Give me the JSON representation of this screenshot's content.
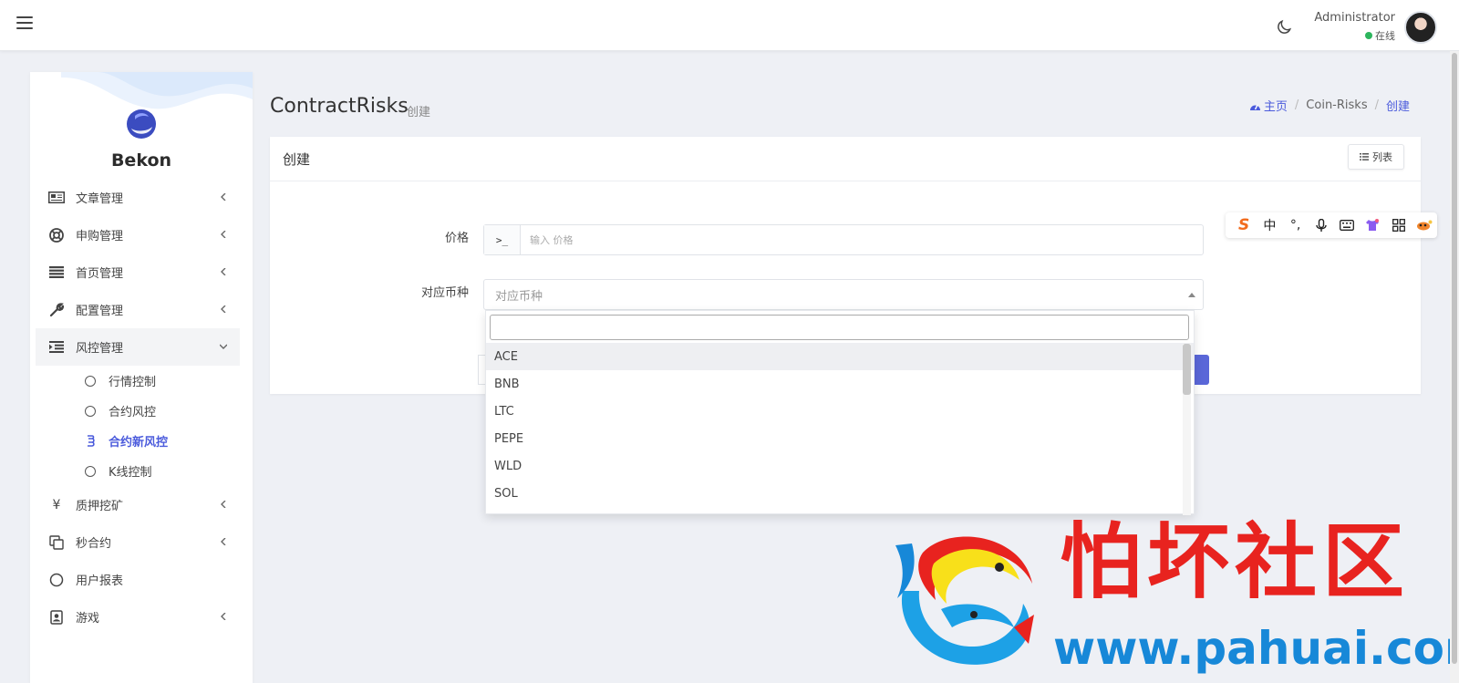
{
  "header": {
    "user_name": "Administrator",
    "user_status": "在线"
  },
  "sidebar": {
    "brand": "Bekon",
    "items": [
      {
        "label": "文章管理",
        "icon": "newspaper-icon"
      },
      {
        "label": "申购管理",
        "icon": "lifebuoy-icon"
      },
      {
        "label": "首页管理",
        "icon": "bars-icon"
      },
      {
        "label": "配置管理",
        "icon": "wrench-icon"
      },
      {
        "label": "风控管理",
        "icon": "indent-icon"
      },
      {
        "label": "质押挖矿",
        "icon": "yen-icon"
      },
      {
        "label": "秒合约",
        "icon": "copy-icon"
      },
      {
        "label": "用户报表",
        "icon": "circle-icon"
      },
      {
        "label": "游戏",
        "icon": "user-card-icon"
      }
    ],
    "subitems": [
      {
        "label": "行情控制"
      },
      {
        "label": "合约风控"
      },
      {
        "label": "合约新风控"
      },
      {
        "label": "K线控制"
      }
    ]
  },
  "page": {
    "title": "ContractRisks",
    "subtitle": "创建"
  },
  "breadcrumb": {
    "home": "主页",
    "section": "Coin-Risks",
    "current": "创建"
  },
  "card": {
    "title": "创建",
    "list_button": "列表"
  },
  "form": {
    "price_label": "价格",
    "price_addon": ">_",
    "price_placeholder": "输入 价格",
    "coin_label": "对应币种",
    "coin_placeholder": "对应币种"
  },
  "dropdown": {
    "options": [
      "ACE",
      "BNB",
      "LTC",
      "PEPE",
      "WLD",
      "SOL"
    ]
  },
  "ime": {
    "lang": "中",
    "punct": "°,"
  },
  "watermark": {
    "cn": "怕坏社区",
    "url": "www.pahuai.com"
  },
  "colors": {
    "accent": "#4b5bdc",
    "online": "#2db55d",
    "watermark_red": "#e8231f",
    "watermark_blue": "#1788d8"
  }
}
